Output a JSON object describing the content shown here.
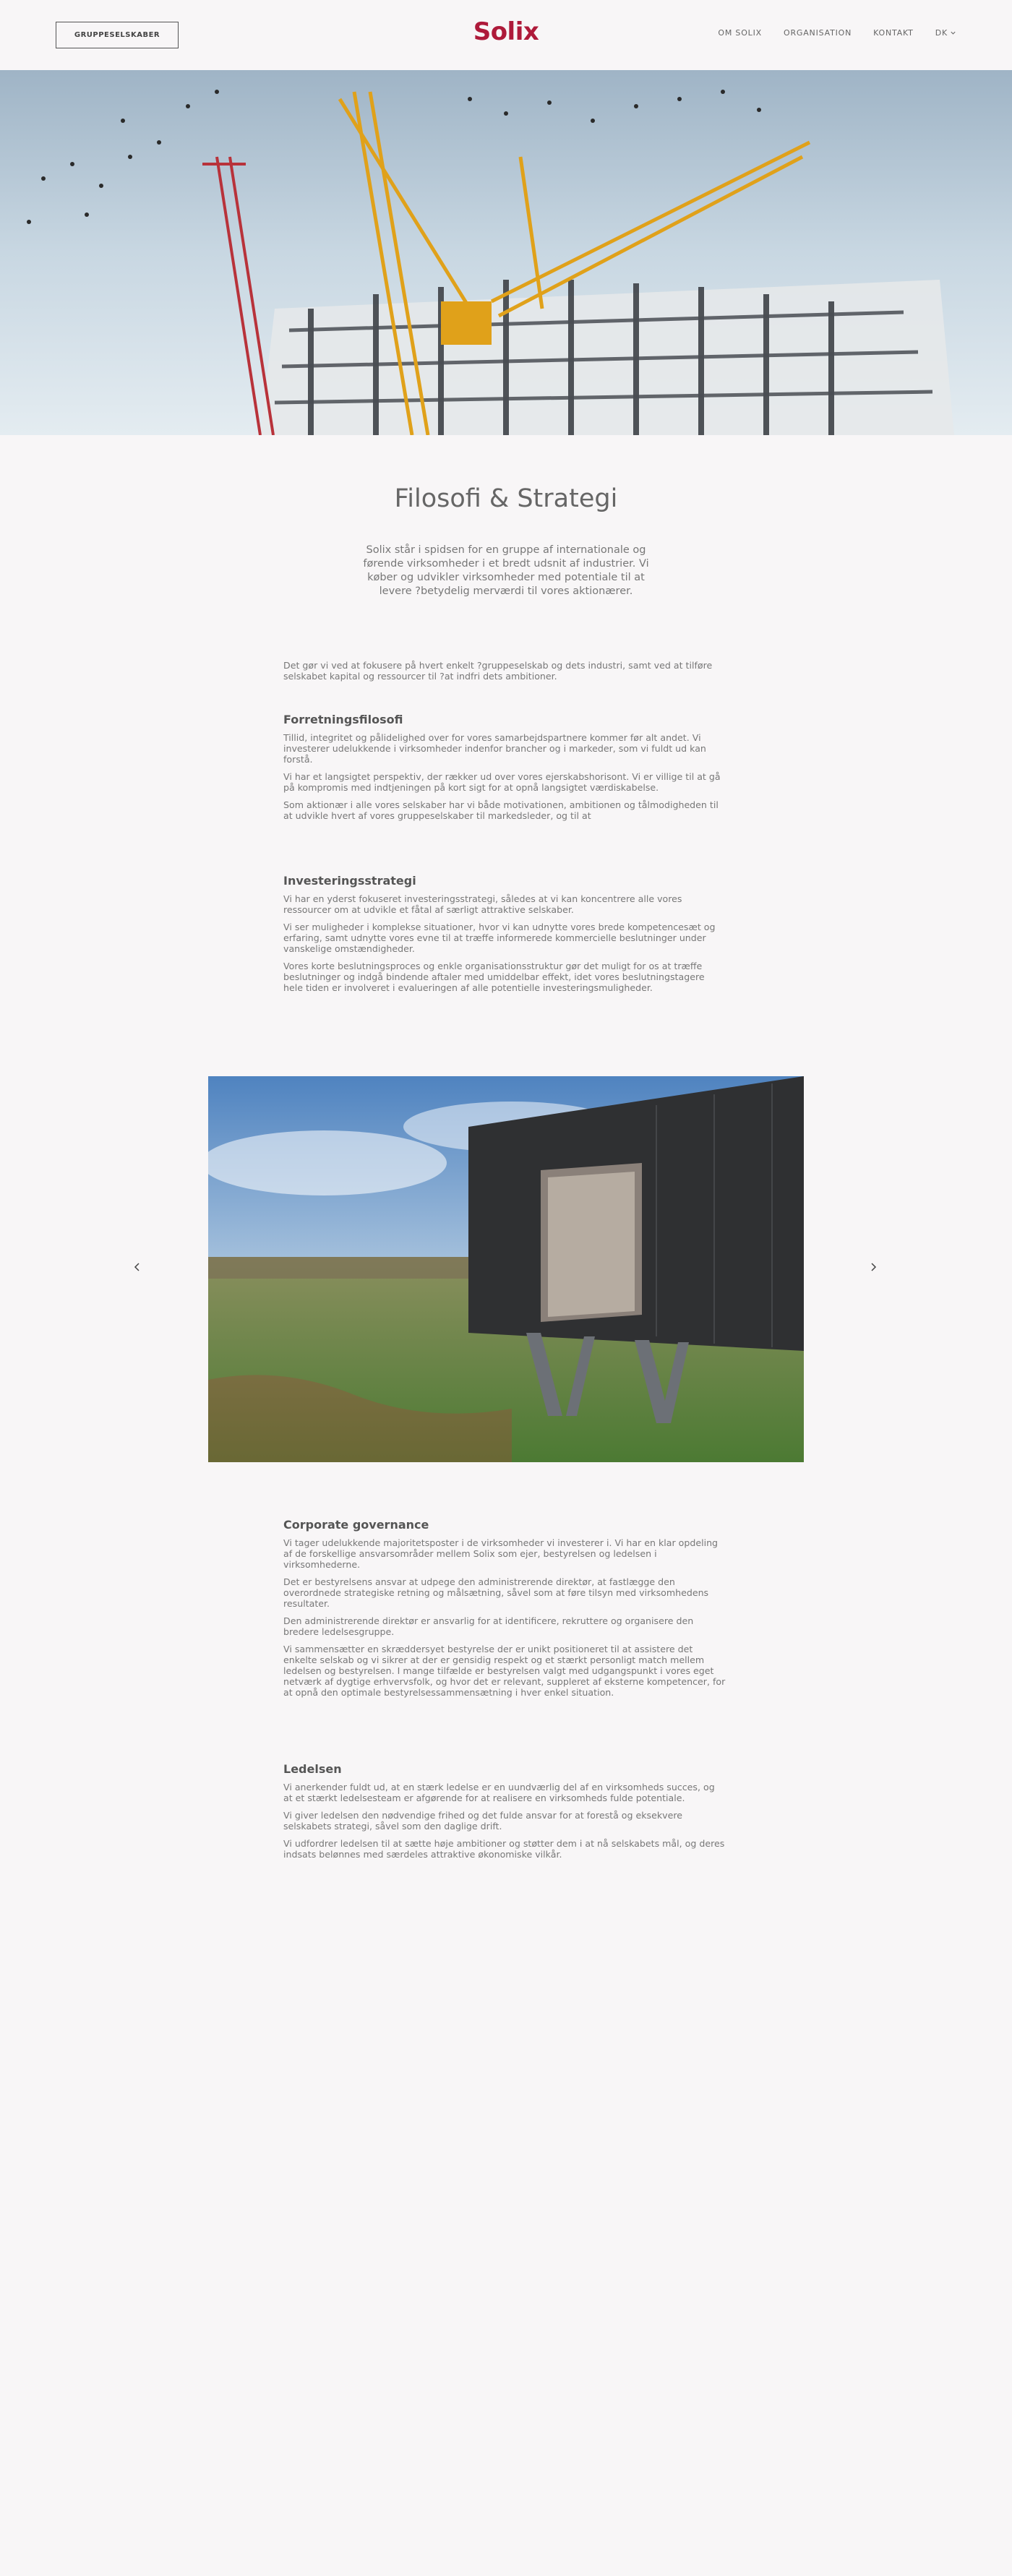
{
  "header": {
    "group_button": "GRUPPESELSKABER",
    "logo": "Solix",
    "nav": [
      "OM SOLIX",
      "ORGANISATION",
      "KONTAKT"
    ],
    "lang": "DK"
  },
  "page": {
    "title": "Filosofi & Strategi",
    "lead": "Solix står i spidsen for en gruppe af internationale og førende virksomheder i et bredt udsnit af industrier. Vi køber og udvikler virksomheder med potentiale til at levere ?betydelig merværdi til vores aktionærer.",
    "intro": "Det gør vi ved at fokusere på hvert enkelt ?gruppeselskab og dets industri, samt ved at tilføre selskabet kapital og ressourcer til ?at indfri dets ambitioner."
  },
  "sections": {
    "business": {
      "heading": "Forretningsfilosofi",
      "paragraphs": [
        "Tillid, integritet og pålidelighed over for vores samarbejdspartnere kommer før alt andet. Vi investerer udelukkende i virksomheder indenfor brancher og i markeder, som vi fuldt ud kan forstå.",
        "Vi har et langsigtet perspektiv, der rækker ud over vores ejerskabshorisont. Vi er villige til at gå på kompromis med indtjeningen på kort sigt for at opnå langsigtet værdiskabelse.",
        "Som aktionær i alle vores selskaber har vi både motivationen, ambitionen og tålmodigheden til at udvikle hvert af vores gruppeselskaber til markedsleder, og til at"
      ]
    },
    "investment": {
      "heading": "Investeringsstrategi",
      "paragraphs": [
        "Vi har en yderst fokuseret investeringsstrategi, således at vi kan koncentrere alle vores ressourcer om at udvikle et fåtal af særligt attraktive selskaber.",
        "Vi ser muligheder i komplekse situationer, hvor vi kan udnytte vores brede kompetencesæt og erfaring, samt udnytte vores evne til at træffe informerede kommercielle beslutninger under vanskelige omstændigheder.",
        "Vores korte beslutningsproces og enkle organisationsstruktur gør det muligt for os at træffe beslutninger og indgå bindende aftaler med umiddelbar effekt, idet vores beslutningstagere hele tiden er involveret i evalueringen af alle potentielle investeringsmuligheder."
      ]
    },
    "governance": {
      "heading": "Corporate governance",
      "paragraphs": [
        "Vi tager udelukkende majoritetsposter i de virksomheder vi investerer i. Vi har en klar opdeling af de forskellige ansvarsområder mellem Solix som ejer, bestyrelsen og ledelsen i virksomhederne.",
        "Det er bestyrelsens ansvar at udpege den administrerende direktør, at fastlægge den overordnede strategiske retning og målsætning, såvel som at føre tilsyn med virksomhedens resultater.",
        "Den administrerende direktør er ansvarlig for at identificere, rekruttere og organisere den bredere ledelsesgruppe.",
        "Vi sammensætter en skræddersyet bestyrelse der er unikt positioneret til at assistere det enkelte selskab og vi sikrer at der er gensidig respekt og et stærkt personligt match mellem ledelsen og bestyrelsen. I mange tilfælde er bestyrelsen valgt med udgangspunkt i vores eget netværk af dygtige erhvervsfolk, og hvor det er relevant, suppleret af eksterne kompetencer, for at opnå den optimale bestyrelsessammensætning i hver enkel situation."
      ]
    },
    "management": {
      "heading": "Ledelsen",
      "paragraphs": [
        "Vi anerkender fuldt ud, at en stærk ledelse er en uundværlig del af en virksomheds succes, og at et stærkt ledelsesteam er afgørende for at realisere en virksomheds fulde potentiale.",
        "Vi giver ledelsen den nødvendige frihed og det fulde ansvar for at forestå og eksekvere selskabets strategi, såvel som den daglige drift.",
        "Vi udfordrer ledelsen til at sætte høje ambitioner og støtter dem i at nå selskabets mål, og deres indsats belønnes med særdeles attraktive økonomiske vilkår."
      ]
    }
  },
  "icons": {
    "lang_chevron": "chevron-down-icon",
    "prev": "chevron-left-icon",
    "next": "chevron-right-icon"
  },
  "colors": {
    "brand": "#ae1a3a",
    "background": "#f8f6f7",
    "text": "#777777"
  }
}
